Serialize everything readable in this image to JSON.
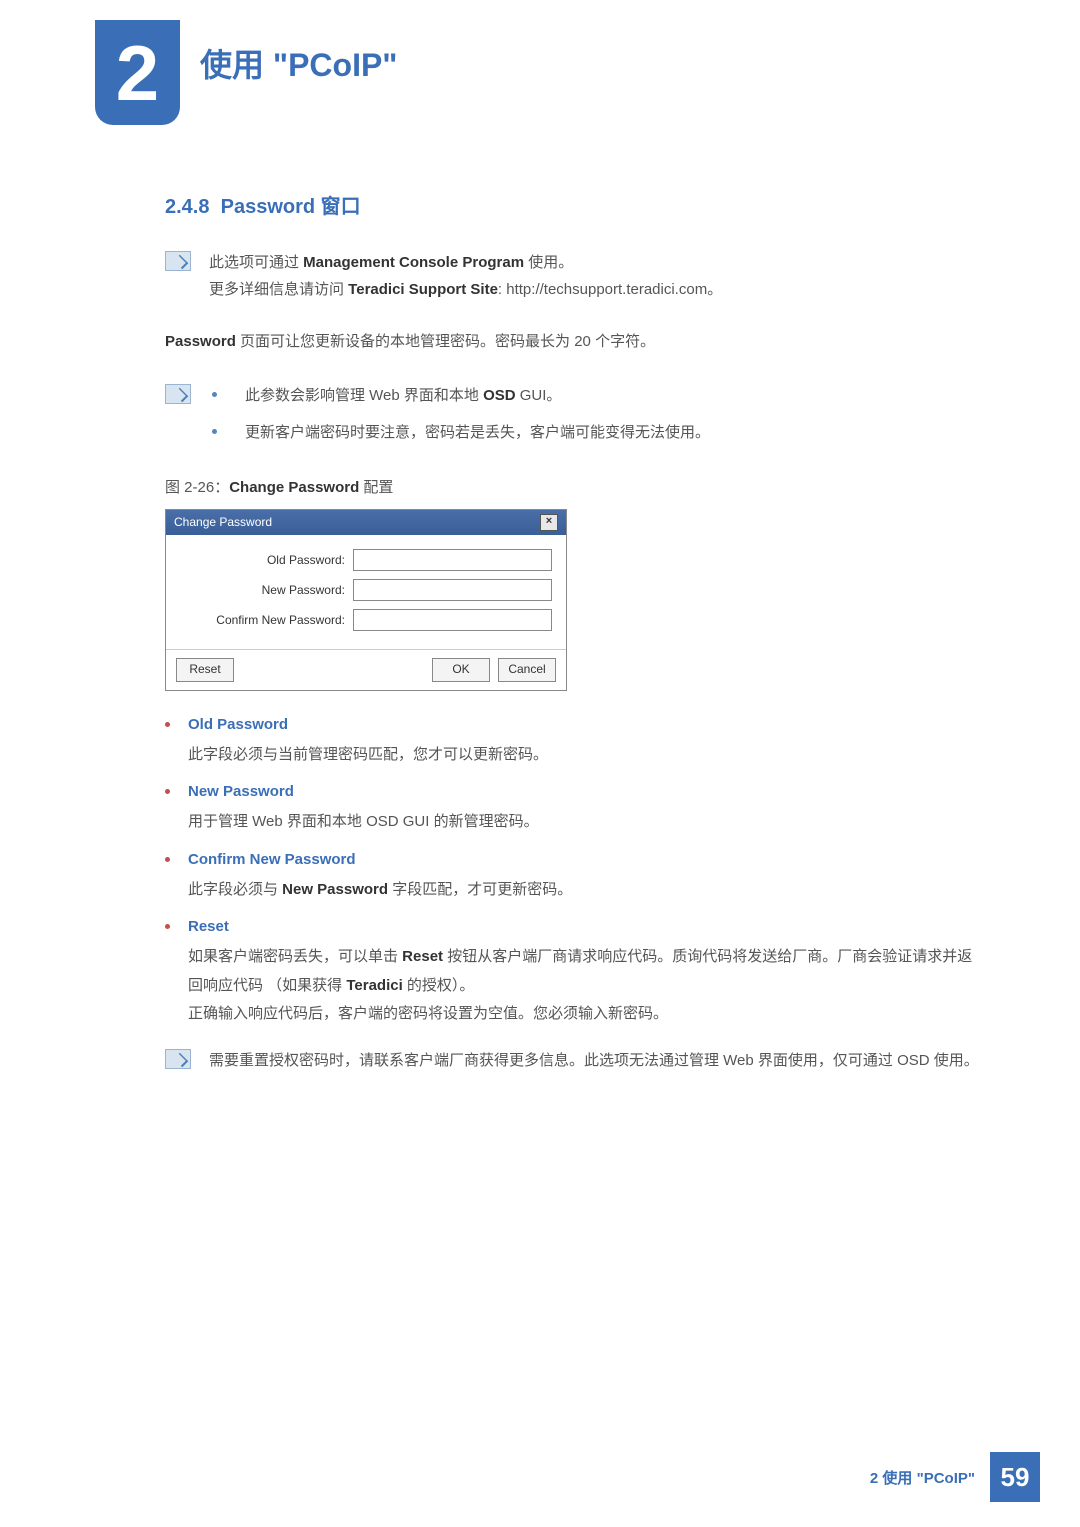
{
  "header": {
    "chapter_number": "2",
    "chapter_title": "使用 \"PCoIP\""
  },
  "section": {
    "number": "2.4.8",
    "title": "Password",
    "suffix": "窗口"
  },
  "note1": {
    "line1_prefix": "此选项可通过 ",
    "line1_bold": "Management Console Program",
    "line1_suffix": " 使用。",
    "line2_prefix": "更多详细信息请访问 ",
    "line2_bold": "Teradici Support Site",
    "line2_suffix": ": http://techsupport.teradici.com。"
  },
  "body1": {
    "bold": "Password",
    "text": " 页面可让您更新设备的本地管理密码。密码最长为 20 个字符。"
  },
  "note2": {
    "bullet1_prefix": "此参数会影响管理 Web 界面和本地 ",
    "bullet1_bold": "OSD",
    "bullet1_suffix": " GUI。",
    "bullet2": "更新客户端密码时要注意，密码若是丢失，客户端可能变得无法使用。"
  },
  "figure": {
    "prefix": "图 2-26：",
    "bold": "Change Password",
    "suffix": " 配置"
  },
  "dialog": {
    "title": "Change Password",
    "field1": "Old Password:",
    "field2": "New Password:",
    "field3": "Confirm New Password:",
    "btn_reset": "Reset",
    "btn_ok": "OK",
    "btn_cancel": "Cancel"
  },
  "defs": [
    {
      "title": "Old Password",
      "body": "此字段必须与当前管理密码匹配，您才可以更新密码。"
    },
    {
      "title": "New Password",
      "body": "用于管理 Web 界面和本地 OSD GUI 的新管理密码。"
    },
    {
      "title": "Confirm New Password",
      "body_prefix": "此字段必须与 ",
      "body_bold": "New Password",
      "body_suffix": " 字段匹配，才可更新密码。"
    },
    {
      "title": "Reset",
      "body_l1_prefix": "如果客户端密码丢失，可以单击 ",
      "body_l1_bold1": "Reset",
      "body_l1_mid": " 按钮从客户端厂商请求响应代码。质询代码将发送给厂商。厂商会验证请求并返回响应代码 （如果获得 ",
      "body_l1_bold2": "Teradici",
      "body_l1_suffix": " 的授权）。",
      "body_l2": "正确输入响应代码后，客户端的密码将设置为空值。您必须输入新密码。"
    }
  ],
  "note3": "需要重置授权密码时，请联系客户端厂商获得更多信息。此选项无法通过管理 Web 界面使用，仅可通过 OSD 使用。",
  "footer": {
    "text": "2 使用 \"PCoIP\"",
    "page": "59"
  }
}
